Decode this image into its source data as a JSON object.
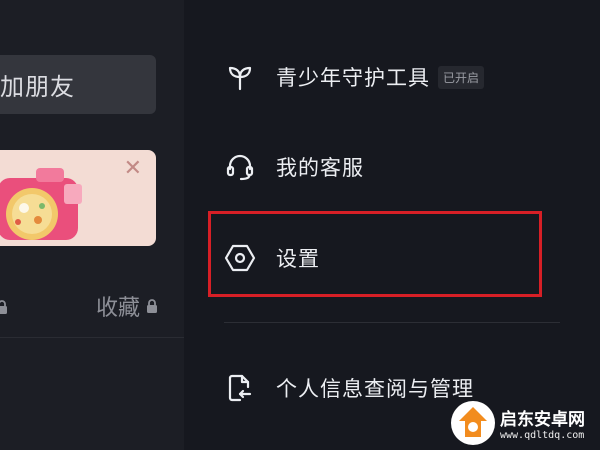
{
  "left_panel": {
    "add_friend_label": "加朋友",
    "promo_close_glyph": "✕",
    "tab_favorites_label": "收藏",
    "icons": [
      "lock-icon"
    ]
  },
  "menu": {
    "items": [
      {
        "label": "青少年守护工具",
        "badge": "已开启",
        "icon": "sprout-icon"
      },
      {
        "label": "我的客服",
        "icon": "headset-icon"
      },
      {
        "label": "设置",
        "icon": "settings-hexagon-icon"
      },
      {
        "label": "个人信息查阅与管理",
        "icon": "document-return-icon"
      }
    ]
  },
  "watermark": {
    "title": "启东安卓网",
    "url": "www.qdltdq.com"
  },
  "colors": {
    "background": "#16181f",
    "left_panel": "#1c1e25",
    "highlight": "#d71f26",
    "text": "#eceef2",
    "muted": "#8d8f97"
  }
}
